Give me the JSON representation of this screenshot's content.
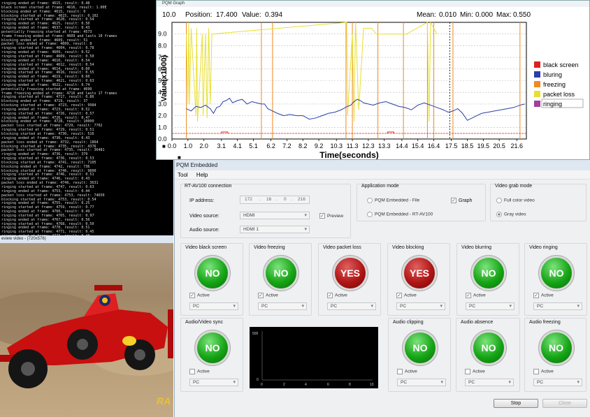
{
  "console": {
    "lines": [
      "ringing ended at frame: 4615, result: 0.48",
      "black screen started at frame: 4616, result: 1.00E",
      "blocking ended at frame: 4615, result: 0",
      "blocking started at frame: 4615, result: 0.102",
      "ringing started at frame: 4620, result: 0.54",
      "ringing ended at frame: 4625, result: 0.50",
      "ringing ended at frame: 4637, result: 0.43",
      "potentially freezing started at frame: 4573",
      "frame freezing ended at frame: 4609 and lasts 10 frames",
      "blocking ended at frame: 4609, result: 51",
      "packet loss ended at frame: 4609, result: 8",
      "ringing started at frame: 4604, result: 0.78",
      "ringing ended at frame: 4609, result: 0.52",
      "ringing started at frame: 4609, result: 0.50",
      "ringing ended at frame: 4610, result: 0.54",
      "ringing started at frame: 4612, result: 0.54",
      "ringing ended at frame: 4614, result: 0.60",
      "ringing started at frame: 4616, result: 0.55",
      "ringing ended at frame: 4619, result: 0.60",
      "ringing started at frame: 4621, result: 0.63",
      "ringing ended at frame: 4622, result: 0.74",
      "potentially freezing started at frame: 4690",
      "frame freezing ended at frame: 4716 and lasts 17 frames",
      "ringing started at frame: 4717, result: 0.86",
      "blocking ended at frame: 4719, result: 37",
      "blocking started at frame: 4723, result: 9984",
      "ringing ended at frame: 4723, result: 0.52",
      "ringing started at frame: 4726, result: 0.57",
      "ringing ended at frame: 4726, result: 0.47",
      "blocking ended at frame: 4728, result: 10000",
      "packet loss started at frame: 4729, result: 7702",
      "ringing started at frame: 4729, result: 0.51",
      "blocking started at frame: 4730, result: 516",
      "ringing ended at frame: 4730, result: 0.43",
      "packet loss ended at frame: 4732, result: 1864",
      "blocking started at frame: 4735, result: 4376",
      "packet loss started at frame: 4735, result: 36481",
      "ringing ended at frame: 4736, result: 379",
      "ringing started at frame: 4736, result: 0.53",
      "blocking started at frame: 4741, result: 7105",
      "blocking ended at frame: 4742, result: 736",
      "blocking started at frame: 4746, result: 9800",
      "ringing started at frame: 4746, result: 0.51",
      "ringing ended at frame: 4746, result: 0.43",
      "packet loss ended at frame: 4746, result: 3631",
      "ringing started at frame: 4747, result: 0.63",
      "ringing ended at frame: 4753, result: 0.44",
      "packet loss started at frame: 4753, result: 74650",
      "blocking started at frame: 4753, result: 0.54",
      "ringing ended at frame: 4755, result: 0.25",
      "ringing started at frame: 4759, result: 0.77",
      "ringing ended at frame: 4760, result: 0.49",
      "ringing started at frame: 4765, result: 0.97",
      "ringing ended at frame: 4767, result: 0.50",
      "ringing started at frame: 4768, result: 0.50",
      "ringing ended at frame: 4770, result: 0.51",
      "ringing started at frame: 4771, result: 0.45",
      "ringing ended at frame: 4773, result: 0.48",
      "black screen started at frame: 4778, result: 1.00E",
      "blocking ended at frame: 4778, result: 0",
      "blocking started at frame: 4778, result: 0.102",
      "blocking started at frame: 4787, result: 10000"
    ]
  },
  "preview": {
    "title": "eview video - (720x576)",
    "watermark": "RA"
  },
  "graph": {
    "window_title": "PQM Graph",
    "position_label": "Position:",
    "position_value": "17.400",
    "value_label": "Value:",
    "value_value": "0.394",
    "mean_label": "Mean:",
    "mean_value": "0.010",
    "min_label": "Min:",
    "min_value": "0.000",
    "max_label": "Max:",
    "max_value": "0.550",
    "lock_icon_1": "lock-icon",
    "lock_icon_2": "lock-icon"
  },
  "chart_data": {
    "type": "line",
    "ylabel": "Value(x1000)",
    "xlabel": "Time(seconds)",
    "ylim": [
      0,
      10
    ],
    "xlim": [
      0,
      22.2
    ],
    "y_ticks": [
      "0.0",
      "1.0",
      "2.0",
      "3.0",
      "4.0",
      "5.0",
      "6.0",
      "7.0",
      "8.0",
      "9.0",
      "10.0"
    ],
    "x_ticks": [
      "0.0",
      "1.0",
      "2.0",
      "3.1",
      "4.1",
      "5.1",
      "6.2",
      "7.2",
      "8.2",
      "9.2",
      "10.3",
      "11.3",
      "12.3",
      "13.3",
      "14.4",
      "15.4",
      "16.4",
      "17.5",
      "18.5",
      "19.5",
      "20.5",
      "21.6"
    ],
    "cursor_x": 17.4,
    "legend": [
      {
        "name": "black screen",
        "color": "#e02020"
      },
      {
        "name": "bluring",
        "color": "#2a3fa8"
      },
      {
        "name": "freezing",
        "color": "#f08a20"
      },
      {
        "name": "packet loss",
        "color": "#e8e030"
      },
      {
        "name": "ringing",
        "color": "#a040a0"
      }
    ],
    "series": [
      {
        "name": "bluring",
        "x": [
          0.9,
          1.2,
          1.5,
          1.8,
          2.1,
          2.4,
          2.6,
          2.8,
          3.0,
          3.2,
          3.4,
          3.6,
          3.8,
          4.1,
          4.4,
          4.7,
          5.0,
          5.3,
          5.6,
          5.8,
          6.0,
          6.3,
          6.6,
          7.0,
          7.4,
          7.8,
          8.2,
          8.6,
          9.0,
          9.4,
          9.8,
          10.2,
          10.6,
          11.0,
          11.2,
          11.4,
          11.6,
          11.8,
          12.0,
          12.3,
          12.6,
          13.0,
          13.4,
          13.8,
          14.2,
          14.6,
          15.0,
          15.4,
          15.8,
          16.2,
          16.6,
          17.0,
          17.3,
          17.6,
          17.9,
          18.2,
          18.5,
          18.8,
          19.1,
          19.4,
          19.8,
          20.2,
          20.6,
          21.0,
          21.4,
          21.8,
          22.1
        ],
        "values": [
          2.6,
          2.4,
          2.8,
          2.7,
          2.9,
          2.6,
          2.2,
          2.7,
          2.8,
          3.2,
          3.3,
          3.5,
          3.1,
          3.3,
          3.4,
          3.0,
          3.2,
          3.1,
          3.0,
          3.0,
          2.6,
          2.4,
          2.2,
          2.0,
          2.1,
          2.0,
          2.0,
          1.7,
          1.8,
          2.0,
          2.2,
          2.3,
          2.5,
          2.8,
          2.9,
          3.2,
          3.4,
          3.3,
          3.1,
          3.0,
          2.9,
          3.1,
          3.2,
          3.0,
          2.8,
          2.7,
          2.5,
          2.9,
          3.1,
          2.9,
          2.7,
          2.5,
          2.3,
          2.4,
          2.6,
          2.2,
          1.6,
          1.8,
          2.0,
          2.2,
          2.3,
          2.4,
          2.5,
          2.6,
          2.7,
          2.9,
          3.0
        ]
      },
      {
        "name": "packet loss",
        "x": [
          0.9,
          1.0,
          1.05,
          1.1,
          1.2,
          1.5,
          1.55,
          1.6,
          1.9,
          1.95,
          2.1,
          2.2,
          2.3,
          2.4,
          2.5,
          10.95,
          11.0,
          11.3,
          11.4,
          11.5,
          11.7,
          12.0,
          12.5,
          12.8,
          14.7,
          16.0,
          16.1,
          16.2,
          16.6
        ],
        "values": [
          9.0,
          3.0,
          10.0,
          3.0,
          9.5,
          2.0,
          9.5,
          1.5,
          9.0,
          2.0,
          9.0,
          1.8,
          9.5,
          3.0,
          9.0,
          10.0,
          2.0,
          9.0,
          1.5,
          10.0,
          2.5,
          9.5,
          9.5,
          9.0,
          9.0,
          10.0,
          1.5,
          10.0,
          9.0
        ]
      },
      {
        "name": "freezing",
        "x": [
          0.9,
          5.6,
          6.3,
          10.9,
          11.3,
          12.9,
          14.5,
          16.0,
          16.4,
          17.6,
          21.8
        ],
        "values": [
          10.0,
          10.0,
          10.0,
          10.0,
          10.0,
          10.0,
          10.0,
          10.0,
          10.0,
          10.0,
          10.0
        ]
      },
      {
        "name": "black screen",
        "x": [
          3.1,
          3.5,
          13.5,
          13.9
        ],
        "values": [
          0.6,
          0.6,
          0.6,
          0.6
        ]
      }
    ]
  },
  "app": {
    "window_title": "PQM Embedded",
    "menu": [
      "Tool",
      "Help"
    ],
    "connection": {
      "group_title": "RT-AV100 connection",
      "ip_label": "IP address:",
      "ip_octets": [
        "172",
        "16",
        "0",
        "216"
      ],
      "ip_dot": ".",
      "video_source_label": "Video source:",
      "video_source_value": "HDMI",
      "audio_source_label": "Audio source:",
      "audio_source_value": "HDMI 1",
      "preview_label": "Preview",
      "preview_check": "✓"
    },
    "app_mode": {
      "group_title": "Application mode",
      "option_file": "PQM Embedded - File",
      "option_rt": "PQM Embedded - RT-AV100",
      "graph_label": "Graph",
      "graph_check": "✓"
    },
    "grab_mode": {
      "group_title": "Video grab mode",
      "option_full": "Full color video",
      "option_gray": "Gray video"
    },
    "detectors_row1": [
      {
        "title": "Video black screen",
        "state": "NO",
        "active_label": "Active",
        "check": "✓",
        "select": "PC"
      },
      {
        "title": "Video freezing",
        "state": "NO",
        "active_label": "Active",
        "check": "✓",
        "select": "PC"
      },
      {
        "title": "Video packet loss",
        "state": "YES",
        "active_label": "Active",
        "check": "✓",
        "select": "PC"
      },
      {
        "title": "Video blocking",
        "state": "YES",
        "active_label": "Active",
        "check": "✓",
        "select": "PC"
      },
      {
        "title": "Video blurring",
        "state": "NO",
        "active_label": "Active",
        "check": "✓",
        "select": "PC"
      },
      {
        "title": "Video ringing",
        "state": "NO",
        "active_label": "Active",
        "check": "✓",
        "select": "PC"
      }
    ],
    "detectors_row2": [
      {
        "title": "Audio/Video sync",
        "state": "NO",
        "active_label": "Active",
        "check": "",
        "select": "PC"
      },
      {
        "title": "Audio clipping",
        "state": "NO",
        "active_label": "Active",
        "check": "",
        "select": "PC"
      },
      {
        "title": "Audio absence",
        "state": "NO",
        "active_label": "Active",
        "check": "",
        "select": "PC"
      },
      {
        "title": "Audio freezing",
        "state": "NO",
        "active_label": "Active",
        "check": "",
        "select": "PC"
      }
    ],
    "sync_chart": {
      "y_top": "500",
      "y_bottom": "0",
      "x_ticks": [
        "0",
        "2",
        "4",
        "6",
        "8",
        "10"
      ]
    },
    "stop_label": "Stop",
    "close_label": "Close"
  }
}
